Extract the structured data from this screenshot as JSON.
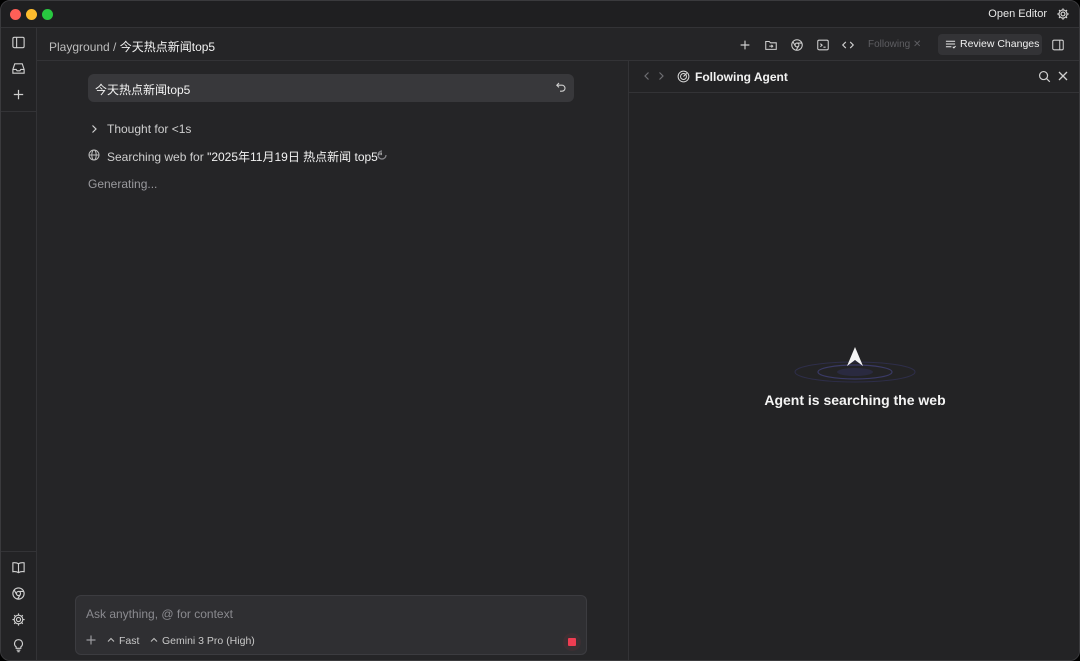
{
  "window": {
    "open_editor_label": "Open Editor"
  },
  "breadcrumb": {
    "parent": "Playground",
    "separator": " / ",
    "current": "今天热点新闻top5"
  },
  "header": {
    "following_label": "Following",
    "review_changes_label": "Review Changes"
  },
  "chat": {
    "user_message": "今天热点新闻top5",
    "thought_label": "Thought for <1s",
    "search_prefix": "Searching web for ",
    "search_query": "\"2025年11月19日 热点新闻 top5\"",
    "generating_label": "Generating..."
  },
  "composer": {
    "placeholder": "Ask anything, @ for context",
    "mode_label": "Fast",
    "model_label": "Gemini 3 Pro (High)"
  },
  "agent_panel": {
    "title": "Following Agent",
    "status": "Agent is searching the web"
  },
  "colors": {
    "background": "#252527",
    "stop_red": "#ef3d52"
  }
}
